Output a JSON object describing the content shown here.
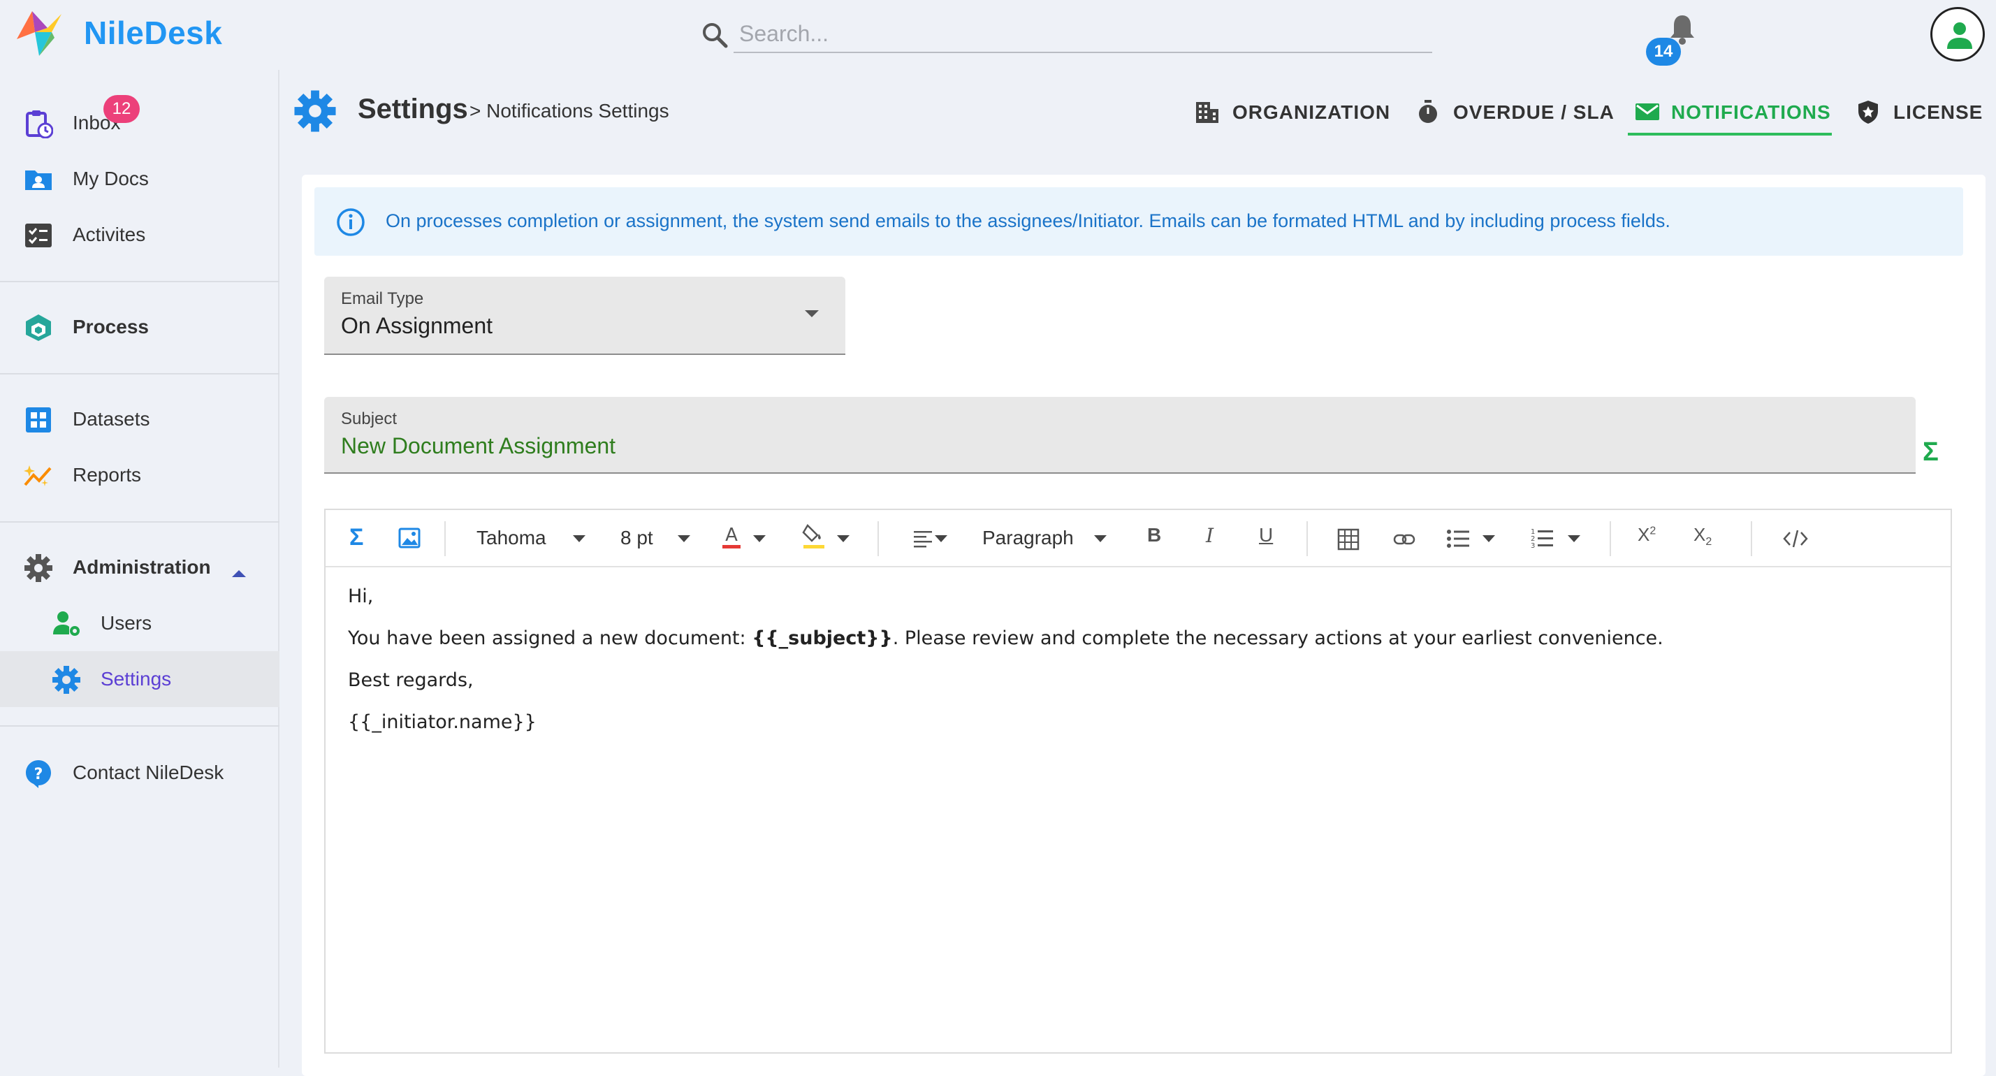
{
  "app": {
    "brand": "NileDesk",
    "search_placeholder": "Search...",
    "notification_count": "14"
  },
  "sidebar": {
    "inbox_badge": "12",
    "items": [
      {
        "label": "Inbox",
        "icon": "clipboard-clock-icon"
      },
      {
        "label": "My Docs",
        "icon": "folder-user-icon"
      },
      {
        "label": "Activites",
        "icon": "checklist-icon"
      },
      {
        "label": "Process",
        "icon": "cube-icon"
      },
      {
        "label": "Datasets",
        "icon": "grid-icon"
      },
      {
        "label": "Reports",
        "icon": "chart-sparkle-icon"
      },
      {
        "label": "Administration",
        "icon": "gear-icon"
      },
      {
        "label": "Users",
        "icon": "user-gear-icon"
      },
      {
        "label": "Settings",
        "icon": "gear-icon"
      },
      {
        "label": "Contact NileDesk",
        "icon": "help-icon"
      }
    ]
  },
  "header": {
    "title": "Settings",
    "breadcrumb": "> Notifications Settings",
    "tabs": [
      {
        "label": "ORGANIZATION",
        "icon": "building-icon"
      },
      {
        "label": "OVERDUE / SLA",
        "icon": "stopwatch-icon"
      },
      {
        "label": "NOTIFICATIONS",
        "icon": "mail-icon",
        "active": true
      },
      {
        "label": "LICENSE",
        "icon": "shield-star-icon"
      }
    ]
  },
  "info": {
    "text": "On processes completion or assignment, the system send emails to the assignees/Initiator. Emails can be formated HTML and by including process fields."
  },
  "form": {
    "email_type_label": "Email Type",
    "email_type_value": "On Assignment",
    "subject_label": "Subject",
    "subject_value": "New Document Assignment"
  },
  "editor": {
    "font": "Tahoma",
    "size": "8 pt",
    "block": "Paragraph",
    "body": {
      "line1": "Hi,",
      "line2_pre": "You have been assigned a new document: ",
      "line2_var": "{{_subject}}",
      "line2_post": ". Please review and complete the necessary actions at your earliest convenience.",
      "line3": "Best regards,",
      "line4": "{{_initiator.name}}"
    }
  },
  "colors": {
    "brand": "#2196f3",
    "accent_green": "#1faa4e",
    "active_nav": "#5b3fd4",
    "badge_pink": "#ec407a",
    "badge_blue": "#1e88e5"
  }
}
